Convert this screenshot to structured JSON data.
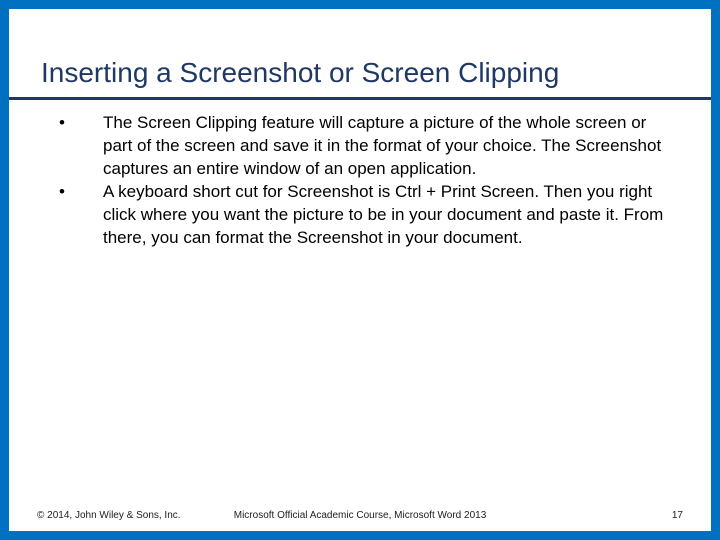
{
  "slide": {
    "title": "Inserting a Screenshot or Screen Clipping",
    "bullets": [
      "The Screen Clipping feature will capture a picture of the whole screen or part of the screen and save it in the format of your choice. The Screenshot captures an entire window of an open application.",
      "A keyboard short cut for Screenshot is Ctrl + Print Screen. Then you right click where you want the picture to be in your document and paste it.  From there, you can format the Screenshot in your document."
    ]
  },
  "footer": {
    "copyright": "© 2014, John Wiley & Sons, Inc.",
    "course": "Microsoft Official Academic Course, Microsoft Word 2013",
    "page": "17"
  },
  "colors": {
    "border": "#0070C0",
    "heading": "#1F3864"
  }
}
